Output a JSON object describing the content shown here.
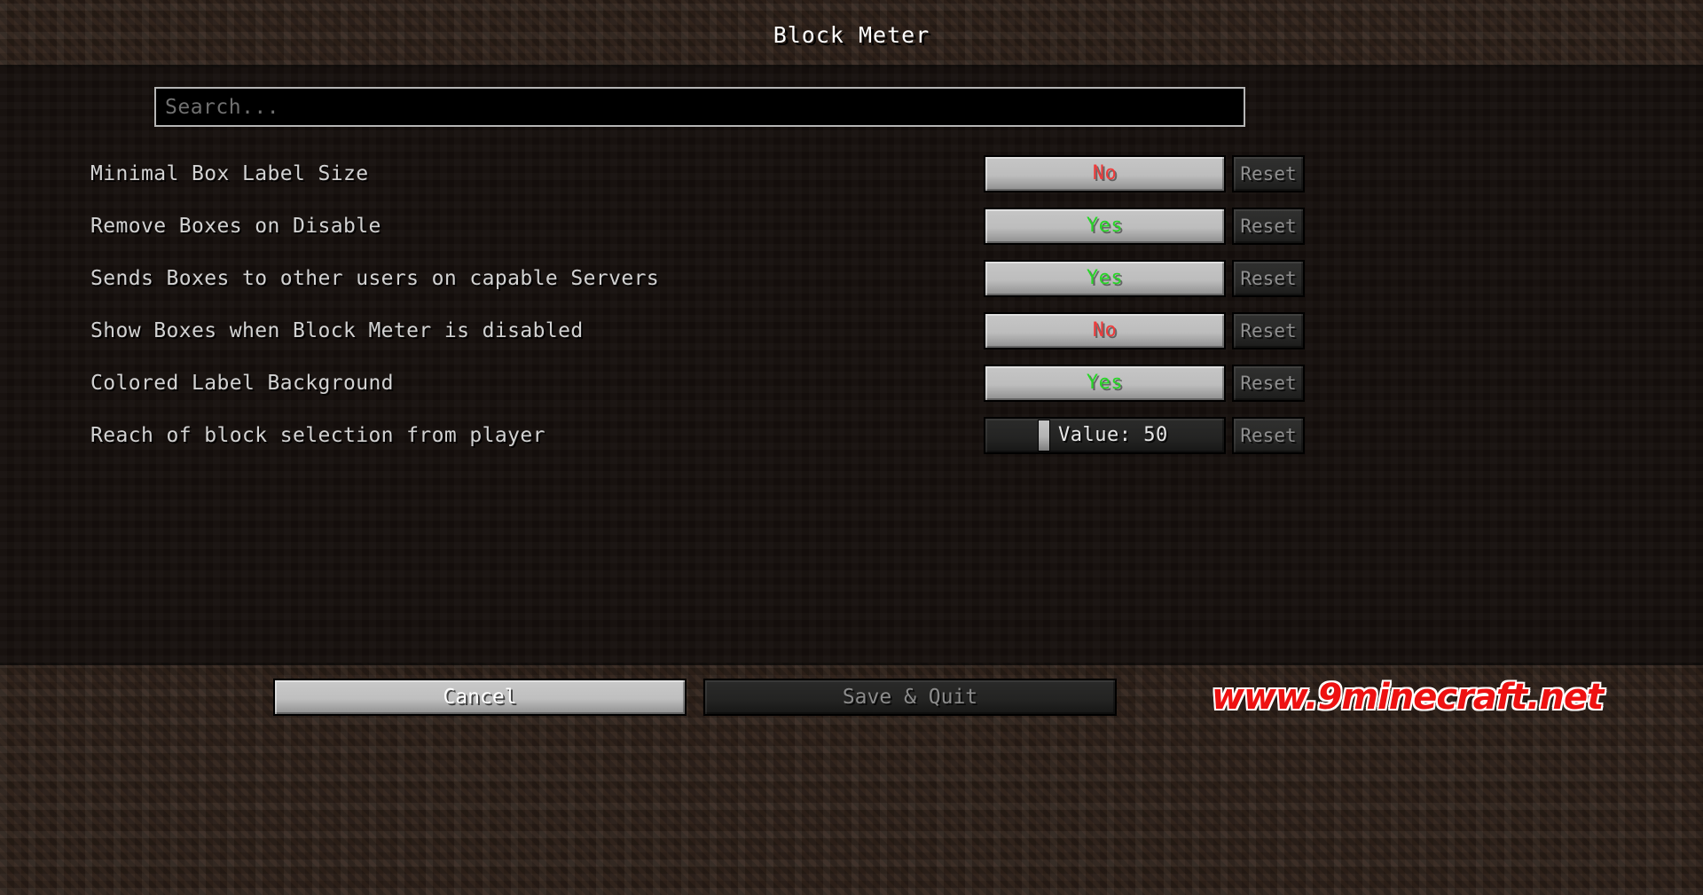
{
  "window": {
    "title": "Block Meter"
  },
  "search": {
    "placeholder": "Search...",
    "value": ""
  },
  "colors": {
    "yes": "#28d628",
    "no": "#ef3b3b",
    "button_face": "#bdbdbd",
    "panel_bg": "#16100d",
    "dirt": "#2b1f18",
    "watermark": "#ee1111"
  },
  "reset_label": "Reset",
  "options": [
    {
      "label": "Minimal Box Label Size",
      "control": "toggle",
      "value": "No",
      "state": "no",
      "reset": "Reset"
    },
    {
      "label": "Remove Boxes on Disable",
      "control": "toggle",
      "value": "Yes",
      "state": "yes",
      "reset": "Reset"
    },
    {
      "label": "Sends Boxes to other users on capable Servers",
      "control": "toggle",
      "value": "Yes",
      "state": "yes",
      "reset": "Reset"
    },
    {
      "label": "Show Boxes when Block Meter is disabled",
      "control": "toggle",
      "value": "No",
      "state": "no",
      "reset": "Reset"
    },
    {
      "label": "Colored Label Background",
      "control": "toggle",
      "value": "Yes",
      "state": "yes",
      "reset": "Reset"
    },
    {
      "label": "Reach of block selection from player",
      "control": "slider",
      "value": "Value: 50",
      "slider_percent": 22,
      "reset": "Reset"
    }
  ],
  "footer": {
    "cancel_label": "Cancel",
    "save_label": "Save & Quit",
    "watermark": "www.9minecraft.net"
  }
}
